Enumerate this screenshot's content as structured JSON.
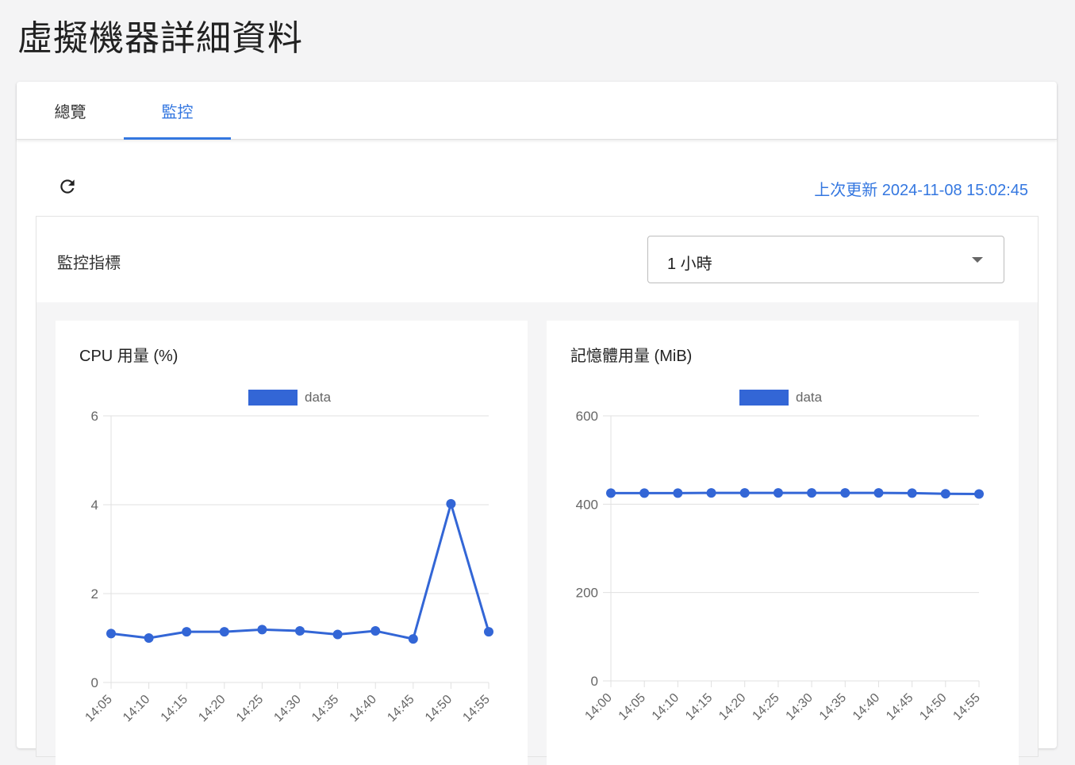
{
  "page": {
    "title": "虛擬機器詳細資料"
  },
  "tabs": [
    {
      "label": "總覽",
      "active": false
    },
    {
      "label": "監控",
      "active": true
    }
  ],
  "toolbar": {
    "refresh_icon": "refresh-icon",
    "last_update_label": "上次更新",
    "last_update_value": "2024-11-08 15:02:45"
  },
  "metrics": {
    "label": "監控指標",
    "range_value": "1 小時"
  },
  "colors": {
    "accent": "#3477e0",
    "series": "#3366d6",
    "grid": "#e0e0e0"
  },
  "chart_data": [
    {
      "type": "line",
      "title": "CPU 用量 (%)",
      "legend": "top-center",
      "grid": true,
      "x": [
        "14:05",
        "14:10",
        "14:15",
        "14:20",
        "14:25",
        "14:30",
        "14:35",
        "14:40",
        "14:45",
        "14:50",
        "14:55"
      ],
      "series": [
        {
          "name": "data",
          "values": [
            1.1,
            1.0,
            1.14,
            1.14,
            1.19,
            1.16,
            1.08,
            1.16,
            0.98,
            4.02,
            1.14
          ]
        }
      ],
      "ylim": [
        0,
        6
      ],
      "yticks": [
        0,
        2,
        4,
        6
      ]
    },
    {
      "type": "line",
      "title": "記憶體用量 (MiB)",
      "legend": "top-center",
      "grid": true,
      "x": [
        "14:00",
        "14:05",
        "14:10",
        "14:15",
        "14:20",
        "14:25",
        "14:30",
        "14:35",
        "14:40",
        "14:45",
        "14:50",
        "14:55"
      ],
      "series": [
        {
          "name": "data",
          "values": [
            425,
            425,
            425,
            425.5,
            425.5,
            425.5,
            425.5,
            425.5,
            425.5,
            425,
            423.5,
            423
          ]
        }
      ],
      "ylim": [
        0,
        600
      ],
      "yticks": [
        0,
        200,
        400,
        600
      ]
    }
  ]
}
